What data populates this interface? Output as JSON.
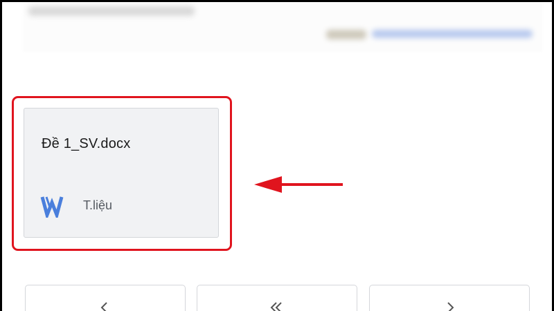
{
  "attachment": {
    "file_name": "Đề 1_SV.docx",
    "file_type": "T.liệu",
    "icon": "word-icon",
    "icon_color": "#4a7fdc"
  },
  "highlight_color": "#e0141e",
  "arrow_color": "#e0141e",
  "actions": [
    {
      "icon": "reply-icon"
    },
    {
      "icon": "reply-all-icon"
    },
    {
      "icon": "forward-icon"
    }
  ]
}
